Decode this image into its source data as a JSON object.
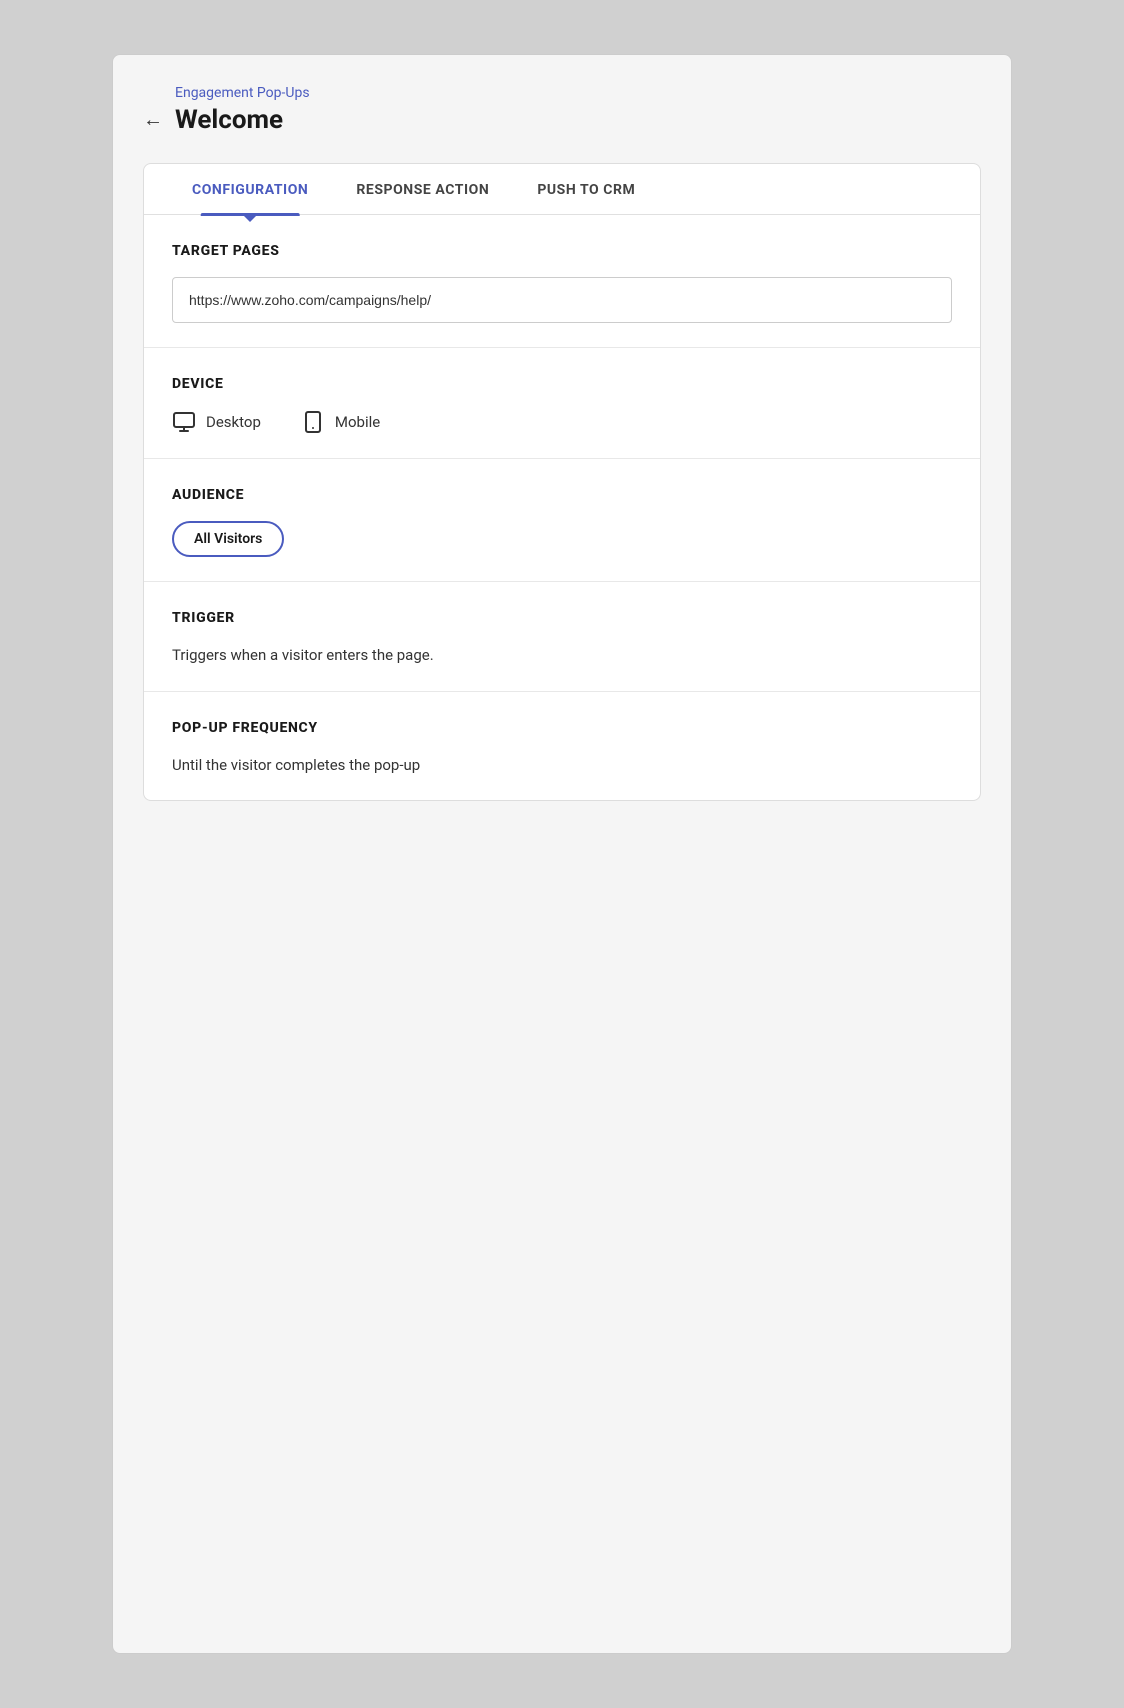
{
  "header": {
    "breadcrumb": "Engagement Pop-Ups",
    "title": "Welcome",
    "back_label": "←"
  },
  "tabs": [
    {
      "id": "configuration",
      "label": "CONFIGURATION",
      "active": true
    },
    {
      "id": "response_action",
      "label": "RESPONSE ACTION",
      "active": false
    },
    {
      "id": "push_to_crm",
      "label": "PUSH TO CRM",
      "active": false
    }
  ],
  "sections": {
    "target_pages": {
      "title": "TARGET PAGES",
      "url_value": "https://www.zoho.com/campaigns/help/"
    },
    "device": {
      "title": "DEVICE",
      "options": [
        {
          "id": "desktop",
          "label": "Desktop"
        },
        {
          "id": "mobile",
          "label": "Mobile"
        }
      ]
    },
    "audience": {
      "title": "AUDIENCE",
      "selected": "All Visitors"
    },
    "trigger": {
      "title": "TRIGGER",
      "description": "Triggers when a visitor enters the page."
    },
    "popup_frequency": {
      "title": "POP-UP FREQUENCY",
      "description": "Until the visitor completes the pop-up"
    }
  }
}
